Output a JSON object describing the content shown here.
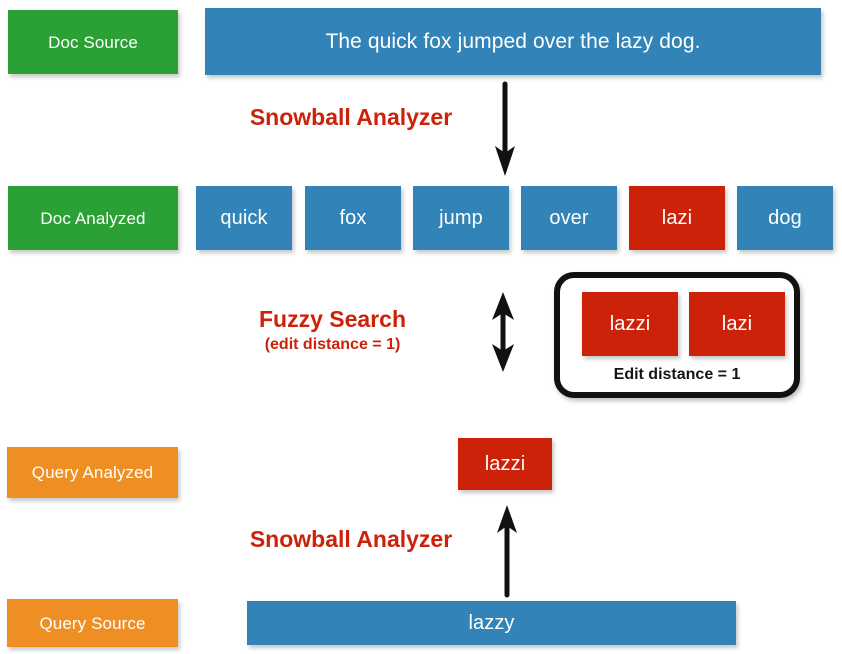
{
  "diagram": {
    "title": "Snowball Analyzer fuzzy search pipeline",
    "colors": {
      "green": "#2ba135",
      "blue": "#3283b8",
      "red": "#cc2209",
      "orange": "#ef8f23",
      "arrow": "#111111",
      "text_light": "#ffffff",
      "text_dark": "#161616"
    }
  },
  "rows": {
    "doc_source": {
      "legend": "Doc Source",
      "sentence": "The quick fox jumped over the lazy dog."
    },
    "doc_analyzed": {
      "legend": "Doc Analyzed",
      "tokens": [
        {
          "text": "quick",
          "highlight": false
        },
        {
          "text": "fox",
          "highlight": false
        },
        {
          "text": "jump",
          "highlight": false
        },
        {
          "text": "over",
          "highlight": false
        },
        {
          "text": "lazi",
          "highlight": true
        },
        {
          "text": "dog",
          "highlight": false
        }
      ]
    },
    "query_analyzed": {
      "legend": "Query Analyzed",
      "token": "lazzi"
    },
    "query_source": {
      "legend": "Query Source",
      "text": "lazzy"
    }
  },
  "annotations": {
    "doc_analyzer": "Snowball Analyzer",
    "query_analyzer": "Snowball Analyzer",
    "fuzzy_title": "Fuzzy Search",
    "fuzzy_subtitle": "(edit distance = 1)"
  },
  "match_group": {
    "left_term": "lazzi",
    "right_term": "lazi",
    "caption": "Edit distance = 1"
  }
}
